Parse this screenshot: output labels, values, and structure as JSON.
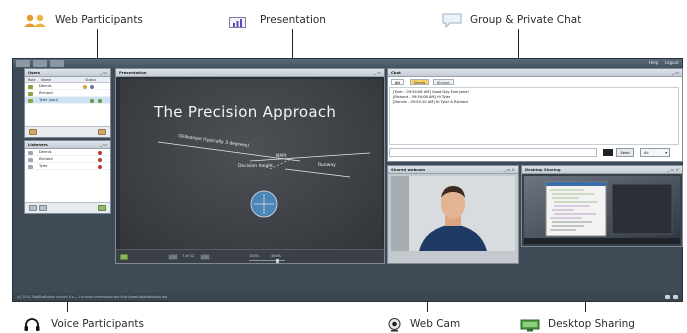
{
  "callouts": {
    "web_participants": "Web Participants",
    "presentation": "Presentation",
    "group_chat": "Group & Private Chat",
    "voice_participants": "Voice Participants",
    "web_cam": "Web Cam",
    "desktop_sharing": "Desktop Sharing"
  },
  "topbar": {
    "help": "Help",
    "logout": "Logout"
  },
  "users_panel": {
    "title": "Users",
    "columns": [
      "Role",
      "Name",
      "Status"
    ],
    "items": [
      {
        "name": "Dennis"
      },
      {
        "name": "Richard"
      },
      {
        "name": "Tyler (you)"
      }
    ]
  },
  "listeners_panel": {
    "title": "Listeners",
    "items": [
      {
        "name": "Dennis"
      },
      {
        "name": "Richard"
      },
      {
        "name": "Tyler"
      }
    ]
  },
  "presentation_panel": {
    "title": "Presentation",
    "slide_title": "The Precision Approach",
    "labels": {
      "glideslope": "Glideslope (typically 3 degrees)",
      "mapt": "MAPt",
      "decision_height": "Decision height",
      "runway": "Runway"
    },
    "page_indicator": "7 of 12",
    "zoom_left": "100%",
    "zoom_right": "400%"
  },
  "chat_panel": {
    "title": "Chat",
    "tabs": [
      "All",
      "Dennis",
      "Richard"
    ],
    "messages": [
      "[Tyler - 09:54:06 AM] Good Day Everyone!",
      "[Richard - 09:54:08 AM] Hi Tyler",
      "[Dennis - 09:54:10 AM] Hi Tyler & Richard"
    ],
    "send_label": "Send",
    "color_label": "All"
  },
  "webcam_panel": {
    "title": "Shared webcam"
  },
  "desktop_panel": {
    "title": "Desktop Sharing"
  },
  "statusbar": {
    "text": "(c) 2010, BigBlueButton version 0.x — For more information see http://www.bigbluebutton.org"
  },
  "colors": {
    "frame": "#3e4a56",
    "panel_header": "#c3cbd4",
    "chalkboard": "#3a3e43",
    "selection": "#cfe3f6"
  }
}
